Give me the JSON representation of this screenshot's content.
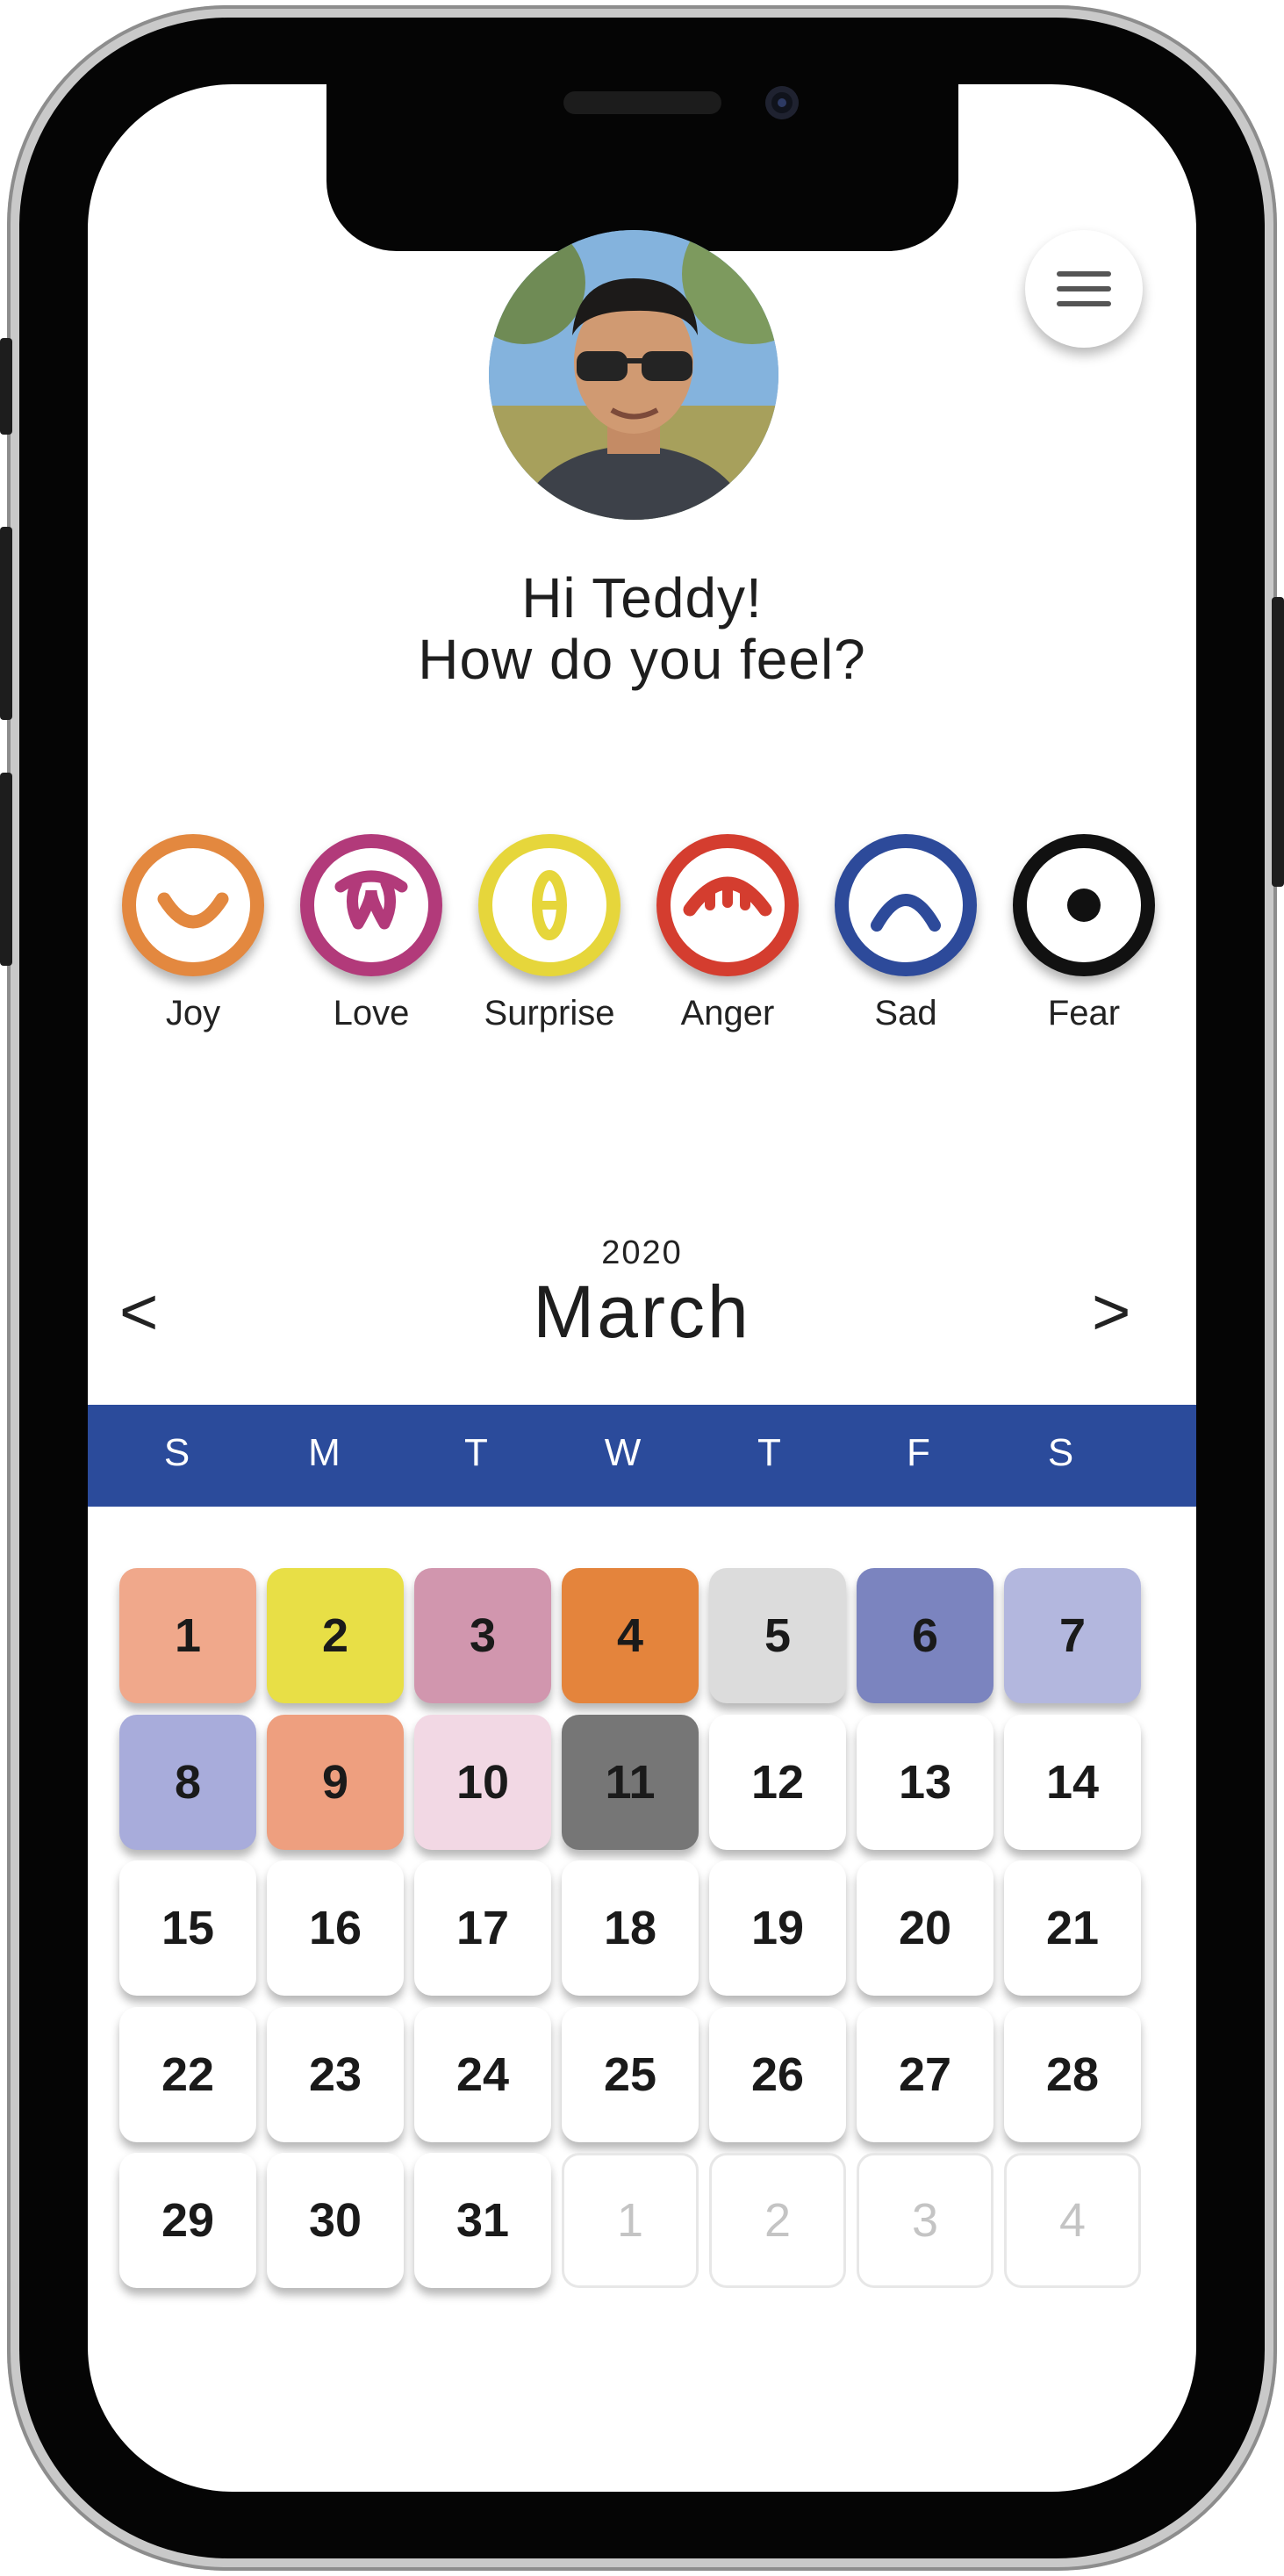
{
  "greeting": {
    "line1": "Hi Teddy!",
    "line2": "How do you feel?"
  },
  "menu_icon": "hamburger-menu-icon",
  "moods": [
    {
      "label": "Joy",
      "color": "#e3883f",
      "icon": "smile-icon"
    },
    {
      "label": "Love",
      "color": "#b23a7a",
      "icon": "love-icon"
    },
    {
      "label": "Surprise",
      "color": "#e6d63b",
      "icon": "surprise-icon"
    },
    {
      "label": "Anger",
      "color": "#d43d2f",
      "icon": "anger-icon"
    },
    {
      "label": "Sad",
      "color": "#2d4a9a",
      "icon": "sad-icon"
    },
    {
      "label": "Fear",
      "color": "#111111",
      "icon": "fear-icon"
    }
  ],
  "calendar": {
    "year": "2020",
    "month": "March",
    "prev_label": "<",
    "next_label": ">",
    "header_color": "#2b4b9b",
    "weekdays": [
      "S",
      "M",
      "T",
      "W",
      "T",
      "F",
      "S"
    ],
    "days": [
      {
        "n": "1",
        "bg": "#f0a88b"
      },
      {
        "n": "2",
        "bg": "#e8df46"
      },
      {
        "n": "3",
        "bg": "#d196ae"
      },
      {
        "n": "4",
        "bg": "#e4843c"
      },
      {
        "n": "5",
        "bg": "#dcdcdc"
      },
      {
        "n": "6",
        "bg": "#7b84bf"
      },
      {
        "n": "7",
        "bg": "#b3b7de"
      },
      {
        "n": "8",
        "bg": "#a8acdb"
      },
      {
        "n": "9",
        "bg": "#ee9f7f"
      },
      {
        "n": "10",
        "bg": "#f2d8e4"
      },
      {
        "n": "11",
        "bg": "#767676"
      },
      {
        "n": "12"
      },
      {
        "n": "13"
      },
      {
        "n": "14"
      },
      {
        "n": "15"
      },
      {
        "n": "16"
      },
      {
        "n": "17"
      },
      {
        "n": "18"
      },
      {
        "n": "19"
      },
      {
        "n": "20"
      },
      {
        "n": "21"
      },
      {
        "n": "22"
      },
      {
        "n": "23"
      },
      {
        "n": "24"
      },
      {
        "n": "25"
      },
      {
        "n": "26"
      },
      {
        "n": "27"
      },
      {
        "n": "28"
      },
      {
        "n": "29"
      },
      {
        "n": "30"
      },
      {
        "n": "31"
      },
      {
        "n": "1",
        "dim": true
      },
      {
        "n": "2",
        "dim": true
      },
      {
        "n": "3",
        "dim": true
      },
      {
        "n": "4",
        "dim": true
      }
    ]
  }
}
